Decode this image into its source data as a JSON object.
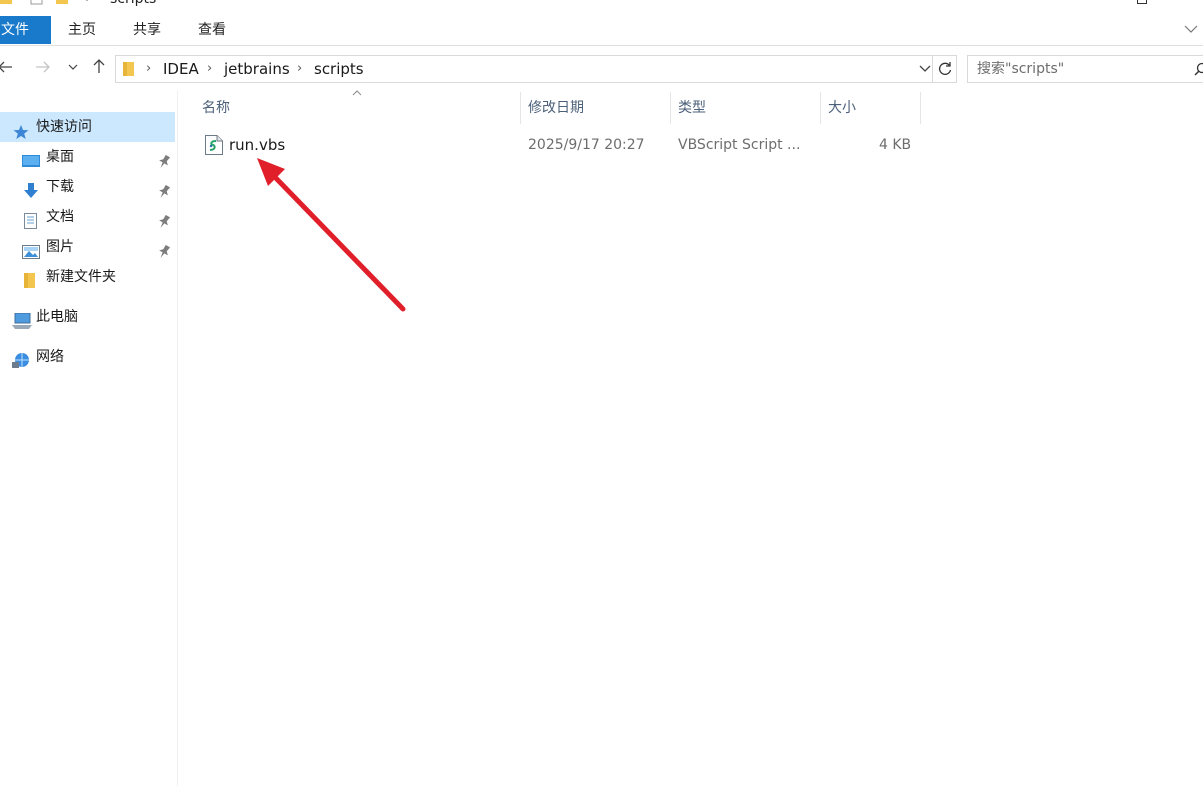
{
  "window": {
    "title": "scripts"
  },
  "ribbon": {
    "tabs": [
      {
        "label": "文件"
      },
      {
        "label": "主页"
      },
      {
        "label": "共享"
      },
      {
        "label": "查看"
      }
    ]
  },
  "address": {
    "crumbs": [
      "IDEA",
      "jetbrains",
      "scripts"
    ],
    "separator": "›"
  },
  "search": {
    "placeholder": "搜索\"scripts\""
  },
  "sidebar": {
    "items": [
      {
        "label": "快速访问",
        "icon": "star-icon",
        "selected": true
      },
      {
        "label": "桌面",
        "icon": "desktop-icon",
        "pinned": true
      },
      {
        "label": "下载",
        "icon": "download-icon",
        "pinned": true
      },
      {
        "label": "文档",
        "icon": "document-icon",
        "pinned": true
      },
      {
        "label": "图片",
        "icon": "pictures-icon",
        "pinned": true
      },
      {
        "label": "新建文件夹",
        "icon": "folder-icon"
      },
      {
        "label": "此电脑",
        "icon": "computer-icon"
      },
      {
        "label": "网络",
        "icon": "network-icon"
      }
    ]
  },
  "columns": {
    "name": "名称",
    "modified": "修改日期",
    "type": "类型",
    "size": "大小"
  },
  "files": [
    {
      "name": "run.vbs",
      "modified": "2025/9/17 20:27",
      "type": "VBScript Script ...",
      "size": "4 KB",
      "icon": "vbscript-file-icon"
    }
  ],
  "colors": {
    "accent": "#1979ca",
    "selection": "#cce8ff",
    "annotation_arrow": "#e01f2a"
  }
}
